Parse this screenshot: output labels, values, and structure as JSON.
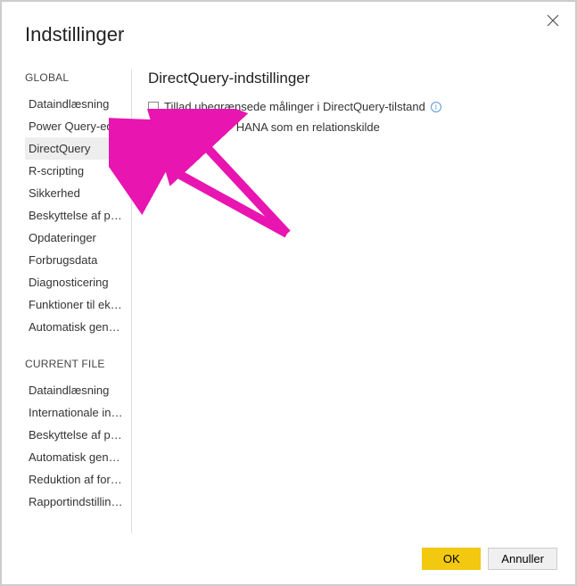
{
  "dialog": {
    "title": "Indstillinger"
  },
  "sidebar": {
    "section1_label": "GLOBAL",
    "section2_label": "CURRENT FILE",
    "global_items": [
      "Dataindlæsning",
      "Power Query-editor",
      "DirectQuery",
      "R-scripting",
      "Sikkerhed",
      "Beskyttelse af pers...",
      "Opdateringer",
      "Forbrugsdata",
      "Diagnosticering",
      "Funktioner til ekse...",
      "Automatisk genda..."
    ],
    "selected_index": 2,
    "currentfile_items": [
      "Dataindlæsning",
      "Internationale inds...",
      "Beskyttelse af pers...",
      "Automatisk genda...",
      "Reduktion af fores...",
      "Rapportindstillinger"
    ]
  },
  "content": {
    "title": "DirectQuery-indstillinger",
    "option1": {
      "label": "Tillad ubegrænsede målinger i DirectQuery-tilstand",
      "checked": false
    },
    "option2": {
      "label": "Behandl SAP HANA som en relationskilde",
      "checked": true
    }
  },
  "buttons": {
    "ok": "OK",
    "cancel": "Annuller"
  }
}
